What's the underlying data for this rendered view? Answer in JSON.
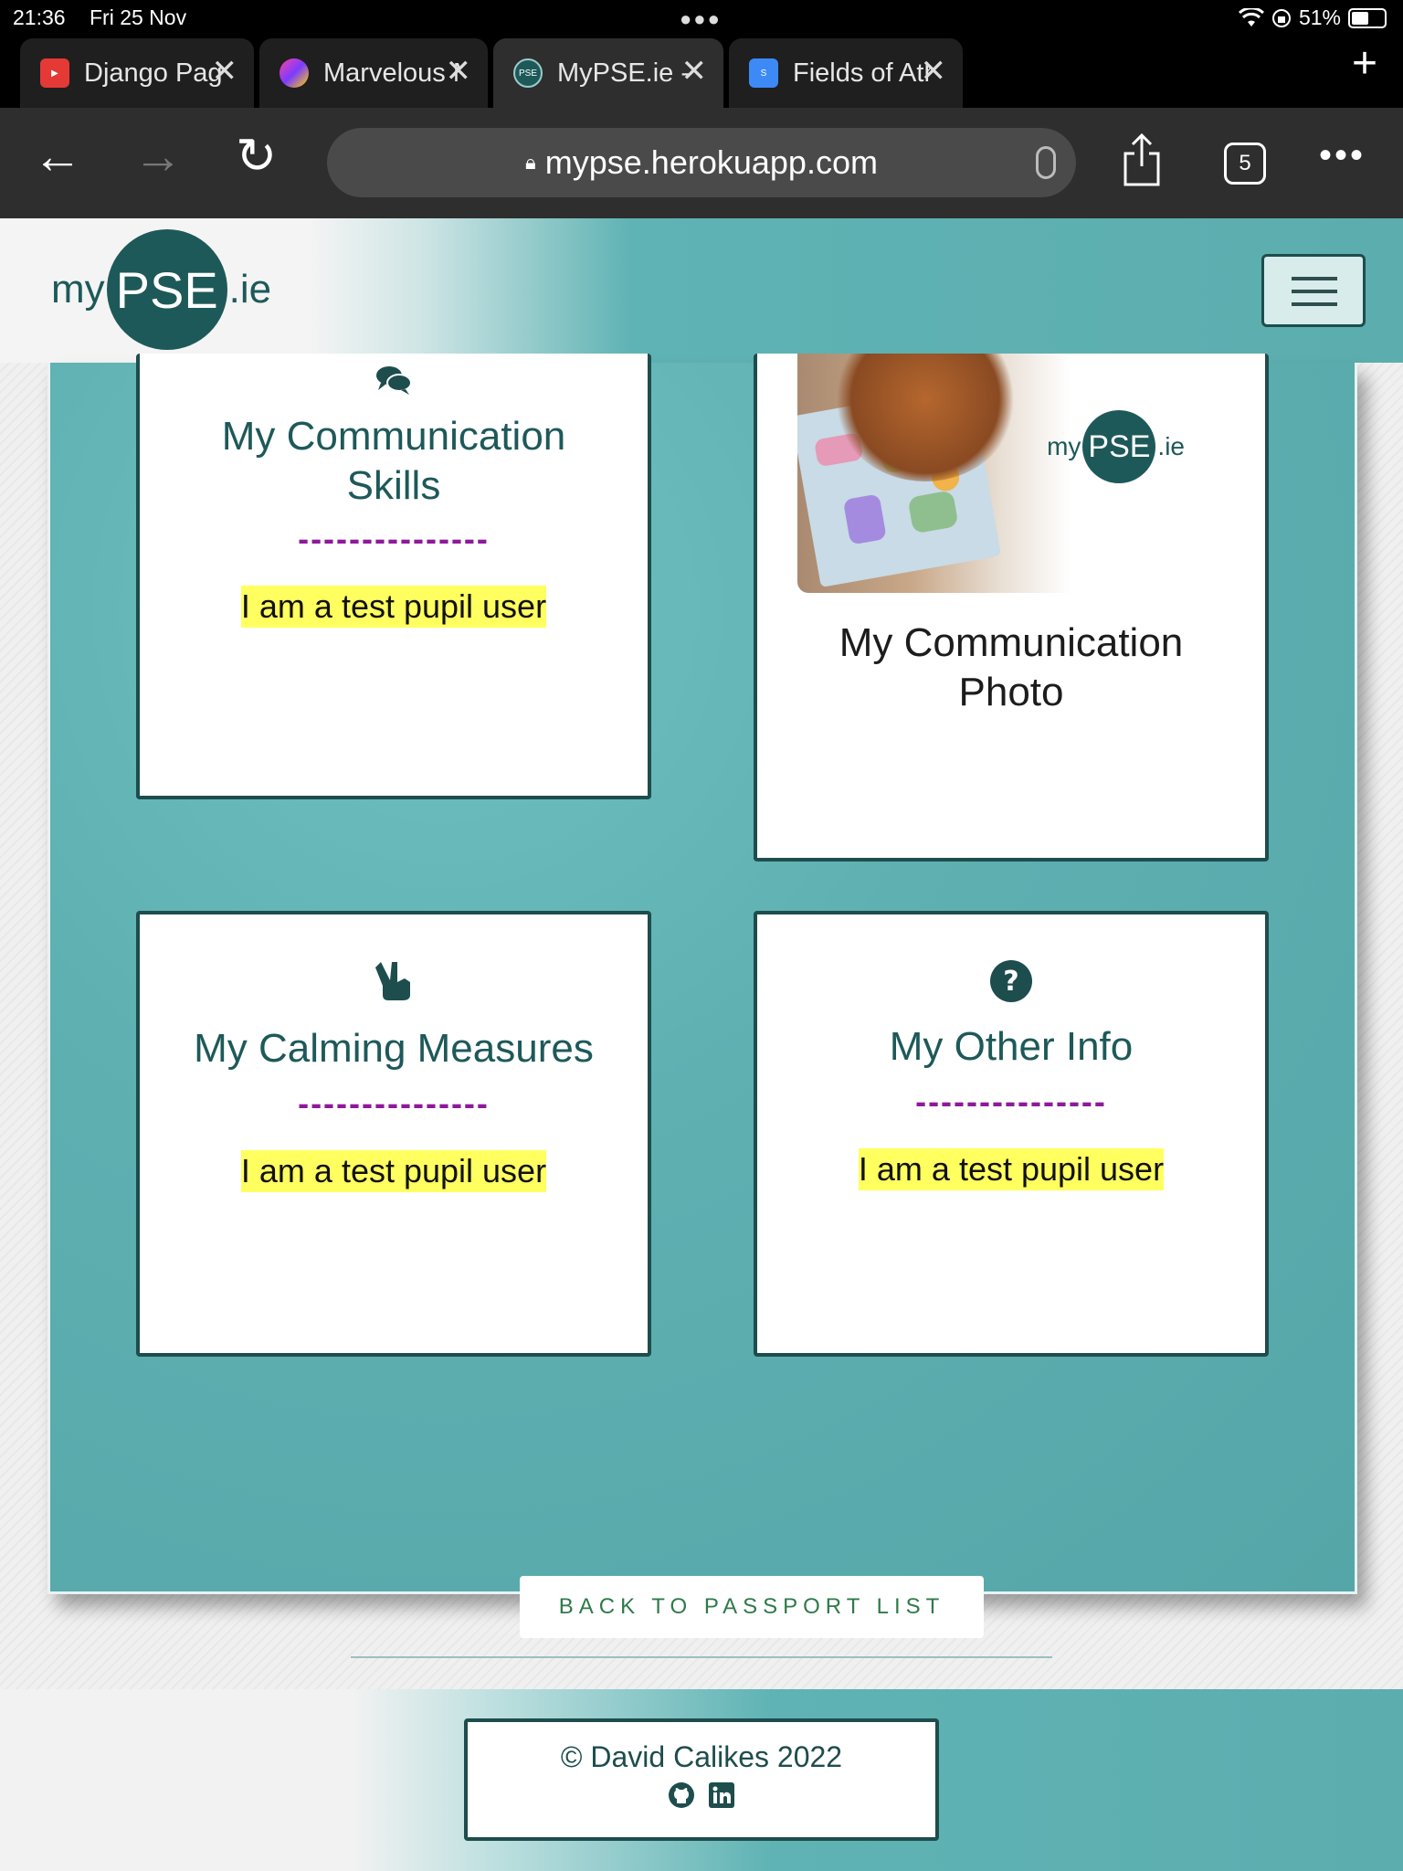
{
  "status": {
    "time": "21:36",
    "date": "Fri 25 Nov",
    "battery": "51%"
  },
  "tabs": [
    {
      "title": "Django Paginat",
      "icon": "youtube-icon"
    },
    {
      "title": "Marvelous Matc",
      "icon": "app-icon"
    },
    {
      "title": "MyPSE.ie - Pas",
      "icon": "pse-icon",
      "icon_text": "PSE",
      "active": true
    },
    {
      "title": "Fields of Athen",
      "icon": "site-icon"
    }
  ],
  "browser": {
    "url": "mypse.herokuapp.com",
    "tab_count": "5"
  },
  "header": {
    "logo_my": "my",
    "logo_pse": "PSE",
    "logo_ie": ".ie"
  },
  "cards": {
    "communication_skills": {
      "title_line1": "My Communication",
      "title_line2": "Skills",
      "divider": "---------------",
      "text": "I am a test pupil user"
    },
    "communication_photo": {
      "title_line1": "My Communication",
      "title_line2": "Photo",
      "logo_my": "my",
      "logo_pse": "PSE",
      "logo_ie": ".ie"
    },
    "calming_measures": {
      "title": "My Calming Measures",
      "divider": "---------------",
      "text": "I am a test pupil user"
    },
    "other_info": {
      "title": "My Other Info",
      "divider": "---------------",
      "text": "I am a test pupil user"
    }
  },
  "back_button": "BACK TO PASSPORT LIST",
  "footer": {
    "copyright": "© David Calikes 2022"
  },
  "colors": {
    "brand": "#1e5959",
    "accent_divider": "#8e1a9a",
    "highlight": "#ffff60"
  }
}
